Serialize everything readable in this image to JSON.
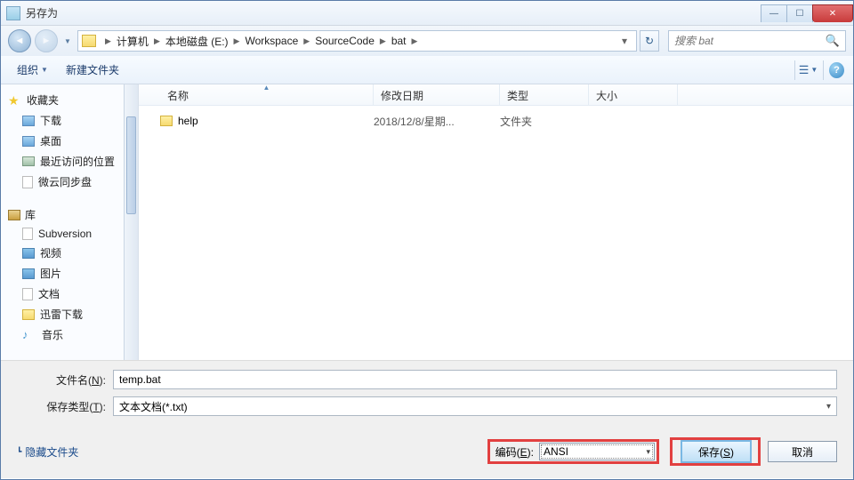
{
  "title": "另存为",
  "breadcrumbs": [
    "计算机",
    "本地磁盘 (E:)",
    "Workspace",
    "SourceCode",
    "bat"
  ],
  "search_placeholder": "搜索 bat",
  "toolbar": {
    "organize": "组织",
    "newfolder": "新建文件夹"
  },
  "sidebar": {
    "favorites": "收藏夹",
    "fav_items": [
      "下载",
      "桌面",
      "最近访问的位置",
      "微云同步盘"
    ],
    "libraries": "库",
    "lib_items": [
      "Subversion",
      "视频",
      "图片",
      "文档",
      "迅雷下载",
      "音乐"
    ]
  },
  "columns": {
    "name": "名称",
    "date": "修改日期",
    "type": "类型",
    "size": "大小"
  },
  "files": [
    {
      "name": "help",
      "date": "2018/12/8/星期...",
      "type": "文件夹"
    }
  ],
  "form": {
    "filename_label": "文件名(N):",
    "filename_value": "temp.bat",
    "savetype_label": "保存类型(T):",
    "savetype_value": "文本文档(*.txt)",
    "hide_folders": "隐藏文件夹",
    "encoding_label": "编码(E):",
    "encoding_value": "ANSI",
    "save": "保存(S)",
    "cancel": "取消"
  }
}
